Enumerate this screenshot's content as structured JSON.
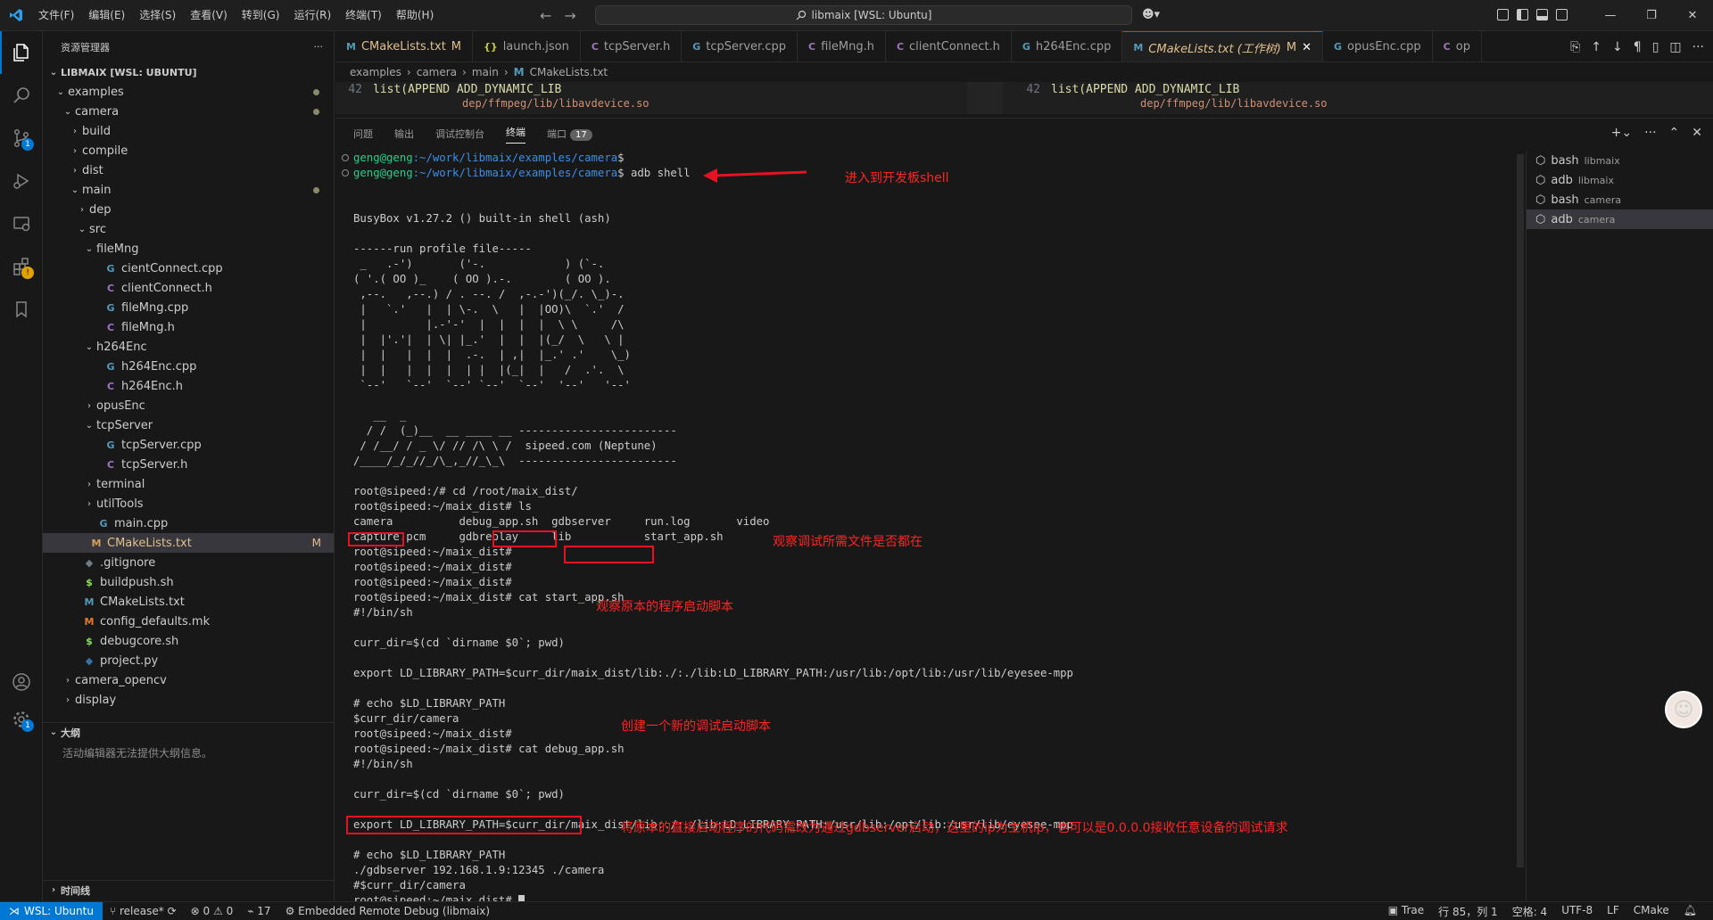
{
  "titlebar": {
    "menu": [
      "文件(F)",
      "编辑(E)",
      "选择(S)",
      "查看(V)",
      "转到(G)",
      "运行(R)",
      "终端(T)",
      "帮助(H)"
    ],
    "search_text": "libmaix [WSL: Ubuntu]"
  },
  "activity": {
    "scm_badge": "1",
    "ext_badge": "!",
    "settings_badge": "1"
  },
  "explorer": {
    "title": "资源管理器",
    "root": "LIBMAIX [WSL: UBUNTU]",
    "items": [
      {
        "label": "examples",
        "depth": 1,
        "chev": "v",
        "icon": "",
        "color": "#cccccc",
        "dot": true
      },
      {
        "label": "camera",
        "depth": 2,
        "chev": "v",
        "icon": "",
        "color": "#cccccc",
        "dot": true
      },
      {
        "label": "build",
        "depth": 3,
        "chev": ">",
        "icon": "",
        "color": "#cccccc"
      },
      {
        "label": "compile",
        "depth": 3,
        "chev": ">",
        "icon": "",
        "color": "#cccccc"
      },
      {
        "label": "dist",
        "depth": 3,
        "chev": ">",
        "icon": "",
        "color": "#cccccc"
      },
      {
        "label": "main",
        "depth": 3,
        "chev": "v",
        "icon": "",
        "color": "#cccccc",
        "dot": true
      },
      {
        "label": "dep",
        "depth": 4,
        "chev": ">",
        "icon": "",
        "color": "#cccccc"
      },
      {
        "label": "src",
        "depth": 4,
        "chev": "v",
        "icon": "",
        "color": "#cccccc"
      },
      {
        "label": "fileMng",
        "depth": 5,
        "chev": "v",
        "icon": "",
        "color": "#cccccc"
      },
      {
        "label": "cientConnect.cpp",
        "depth": 6,
        "chev": "",
        "icon": "G",
        "color": "#519aba"
      },
      {
        "label": "clientConnect.h",
        "depth": 6,
        "chev": "",
        "icon": "C",
        "color": "#a074c4"
      },
      {
        "label": "fileMng.cpp",
        "depth": 6,
        "chev": "",
        "icon": "G",
        "color": "#519aba"
      },
      {
        "label": "fileMng.h",
        "depth": 6,
        "chev": "",
        "icon": "C",
        "color": "#a074c4"
      },
      {
        "label": "h264Enc",
        "depth": 5,
        "chev": "v",
        "icon": "",
        "color": "#cccccc"
      },
      {
        "label": "h264Enc.cpp",
        "depth": 6,
        "chev": "",
        "icon": "G",
        "color": "#519aba"
      },
      {
        "label": "h264Enc.h",
        "depth": 6,
        "chev": "",
        "icon": "C",
        "color": "#a074c4"
      },
      {
        "label": "opusEnc",
        "depth": 5,
        "chev": ">",
        "icon": "",
        "color": "#cccccc"
      },
      {
        "label": "tcpServer",
        "depth": 5,
        "chev": "v",
        "icon": "",
        "color": "#cccccc"
      },
      {
        "label": "tcpServer.cpp",
        "depth": 6,
        "chev": "",
        "icon": "G",
        "color": "#519aba"
      },
      {
        "label": "tcpServer.h",
        "depth": 6,
        "chev": "",
        "icon": "C",
        "color": "#a074c4"
      },
      {
        "label": "terminal",
        "depth": 5,
        "chev": ">",
        "icon": "",
        "color": "#cccccc"
      },
      {
        "label": "utilTools",
        "depth": 5,
        "chev": ">",
        "icon": "",
        "color": "#cccccc"
      },
      {
        "label": "main.cpp",
        "depth": 5,
        "chev": "",
        "icon": "G",
        "color": "#519aba"
      },
      {
        "label": "CMakeLists.txt",
        "depth": 4,
        "chev": "",
        "icon": "M",
        "color": "#d4a05a",
        "selected": true,
        "mod": "M"
      },
      {
        "label": ".gitignore",
        "depth": 3,
        "chev": "",
        "icon": "◆",
        "color": "#6d8086"
      },
      {
        "label": "buildpush.sh",
        "depth": 3,
        "chev": "",
        "icon": "$",
        "color": "#89e051"
      },
      {
        "label": "CMakeLists.txt",
        "depth": 3,
        "chev": "",
        "icon": "M",
        "color": "#519aba"
      },
      {
        "label": "config_defaults.mk",
        "depth": 3,
        "chev": "",
        "icon": "M",
        "color": "#e37933"
      },
      {
        "label": "debugcore.sh",
        "depth": 3,
        "chev": "",
        "icon": "$",
        "color": "#89e051"
      },
      {
        "label": "project.py",
        "depth": 3,
        "chev": "",
        "icon": "◆",
        "color": "#3572a5"
      },
      {
        "label": "camera_opencv",
        "depth": 2,
        "chev": ">",
        "icon": "",
        "color": "#cccccc"
      },
      {
        "label": "display",
        "depth": 2,
        "chev": ">",
        "icon": "",
        "color": "#cccccc"
      }
    ],
    "outline_title": "大纲",
    "outline_empty": "活动编辑器无法提供大纲信息。",
    "timeline_title": "时间线"
  },
  "tabs": [
    {
      "label": "CMakeLists.txt",
      "icon": "M",
      "icon_color": "#519aba",
      "suffix": "M",
      "active": false
    },
    {
      "label": "launch.json",
      "icon": "{}",
      "icon_color": "#cbcb41",
      "suffix": "",
      "active": false
    },
    {
      "label": "tcpServer.h",
      "icon": "C",
      "icon_color": "#a074c4",
      "suffix": "",
      "active": false
    },
    {
      "label": "tcpServer.cpp",
      "icon": "G",
      "icon_color": "#519aba",
      "suffix": "",
      "active": false
    },
    {
      "label": "fileMng.h",
      "icon": "C",
      "icon_color": "#a074c4",
      "suffix": "",
      "active": false
    },
    {
      "label": "clientConnect.h",
      "icon": "C",
      "icon_color": "#a074c4",
      "suffix": "",
      "active": false
    },
    {
      "label": "h264Enc.cpp",
      "icon": "G",
      "icon_color": "#519aba",
      "suffix": "",
      "active": false
    },
    {
      "label": "CMakeLists.txt (工作树)",
      "icon": "M",
      "icon_color": "#519aba",
      "suffix": "M",
      "active": true
    },
    {
      "label": "opusEnc.cpp",
      "icon": "G",
      "icon_color": "#519aba",
      "suffix": "",
      "active": false
    },
    {
      "label": "op",
      "icon": "C",
      "icon_color": "#a074c4",
      "suffix": "",
      "active": false
    }
  ],
  "breadcrumb": [
    "examples",
    "camera",
    "main",
    "CMakeLists.txt"
  ],
  "peek": {
    "line_left": "42",
    "code_left": "list(APPEND ADD_DYNAMIC_LIB",
    "line_right": "42",
    "code_right": "list(APPEND ADD_DYNAMIC_LIB",
    "sub_left": "dep/ffmpeg/lib/libavdevice.so",
    "sub_right": "dep/ffmpeg/lib/libavdevice.so"
  },
  "panel": {
    "tabs": [
      "问题",
      "输出",
      "调试控制台",
      "终端",
      "端口"
    ],
    "ports_count": "17"
  },
  "terminal_lines": [
    {
      "type": "prompt",
      "user": "geng@geng",
      "path": ":~/work/libmaix/examples/camera",
      "cmd": "$",
      "circle": true
    },
    {
      "type": "prompt",
      "user": "geng@geng",
      "path": ":~/work/libmaix/examples/camera",
      "cmd": "$ adb shell",
      "circle": true
    },
    {
      "type": "text",
      "text": ""
    },
    {
      "type": "text",
      "text": ""
    },
    {
      "type": "text",
      "text": "BusyBox v1.27.2 () built-in shell (ash)"
    },
    {
      "type": "text",
      "text": ""
    },
    {
      "type": "text",
      "text": "------run profile file-----"
    },
    {
      "type": "text",
      "text": " _   .-')       ('-.            ) (`-."
    },
    {
      "type": "text",
      "text": "( '.( OO )_    ( OO ).-.        ( OO )."
    },
    {
      "type": "text",
      "text": " ,--.   ,--.) / . --. /  ,-.-')(_/. \\_)-."
    },
    {
      "type": "text",
      "text": " |   `.'   |  | \\-.  \\   |  |OO)\\  `.'  /"
    },
    {
      "type": "text",
      "text": " |         |.-'-'  |  |  |  |  \\ \\     /\\"
    },
    {
      "type": "text",
      "text": " |  |'.'|  | \\| |_.'  |  |  |(_/  \\   \\ |"
    },
    {
      "type": "text",
      "text": " |  |   |  |  |  .-.  | ,|  |_.' .'    \\_)"
    },
    {
      "type": "text",
      "text": " |  |   |  |  |  | |  |(_|  |   /  .'.  \\"
    },
    {
      "type": "text",
      "text": " `--'   `--'  `--' `--'  `--'  '--'   '--'"
    },
    {
      "type": "text",
      "text": ""
    },
    {
      "type": "text",
      "text": "   __  _"
    },
    {
      "type": "text",
      "text": "  / /  (_)__  __ ____ __ ------------------------"
    },
    {
      "type": "text",
      "text": " / /__/ / _ \\/ // /\\ \\ /  sipeed.com (Neptune)"
    },
    {
      "type": "text",
      "text": "/____/_/_//_/\\_,_//_\\_\\  ------------------------"
    },
    {
      "type": "text",
      "text": ""
    },
    {
      "type": "text",
      "text": "root@sipeed:/# cd /root/maix_dist/"
    },
    {
      "type": "text",
      "text": "root@sipeed:~/maix_dist# ls"
    },
    {
      "type": "text",
      "text": "camera          debug_app.sh  gdbserver     run.log       video"
    },
    {
      "type": "text",
      "text": "capture.pcm     gdbreplay     lib           start_app.sh"
    },
    {
      "type": "text",
      "text": "root@sipeed:~/maix_dist#"
    },
    {
      "type": "text",
      "text": "root@sipeed:~/maix_dist#"
    },
    {
      "type": "text",
      "text": "root@sipeed:~/maix_dist#"
    },
    {
      "type": "text",
      "text": "root@sipeed:~/maix_dist# cat start_app.sh"
    },
    {
      "type": "text",
      "text": "#!/bin/sh"
    },
    {
      "type": "text",
      "text": ""
    },
    {
      "type": "text",
      "text": "curr_dir=$(cd `dirname $0`; pwd)"
    },
    {
      "type": "text",
      "text": ""
    },
    {
      "type": "text",
      "text": "export LD_LIBRARY_PATH=$curr_dir/maix_dist/lib:./:./lib:LD_LIBRARY_PATH:/usr/lib:/opt/lib:/usr/lib/eyesee-mpp"
    },
    {
      "type": "text",
      "text": ""
    },
    {
      "type": "text",
      "text": "# echo $LD_LIBRARY_PATH"
    },
    {
      "type": "text",
      "text": "$curr_dir/camera"
    },
    {
      "type": "text",
      "text": "root@sipeed:~/maix_dist#"
    },
    {
      "type": "text",
      "text": "root@sipeed:~/maix_dist# cat debug_app.sh"
    },
    {
      "type": "text",
      "text": "#!/bin/sh"
    },
    {
      "type": "text",
      "text": ""
    },
    {
      "type": "text",
      "text": "curr_dir=$(cd `dirname $0`; pwd)"
    },
    {
      "type": "text",
      "text": ""
    },
    {
      "type": "text",
      "text": "export LD_LIBRARY_PATH=$curr_dir/maix_dist/lib:./:./lib:LD_LIBRARY_PATH:/usr/lib:/opt/lib:/usr/lib/eyesee-mpp"
    },
    {
      "type": "text",
      "text": ""
    },
    {
      "type": "text",
      "text": "# echo $LD_LIBRARY_PATH"
    },
    {
      "type": "text",
      "text": "./gdbserver 192.168.1.9:12345 ./camera"
    },
    {
      "type": "text",
      "text": "#$curr_dir/camera"
    },
    {
      "type": "cursor",
      "text": "root@sipeed:~/maix_dist# "
    }
  ],
  "annotations": {
    "adb_shell": "进入到开发板shell",
    "check_files": "观察调试所需文件是否都在",
    "start_script": "观察原本的程序启动脚本",
    "debug_script": "创建一个新的调试启动脚本",
    "gdbserver_note": "将原本的直接启动程序的代码需改为通过gdbserver启动，这里的ip为主机ip，也可以是0.0.0.0接收任意设备的调试请求"
  },
  "terminals": [
    {
      "name": "bash",
      "sub": "libmaix",
      "active": false
    },
    {
      "name": "adb",
      "sub": "libmaix",
      "active": false
    },
    {
      "name": "bash",
      "sub": "camera",
      "active": false
    },
    {
      "name": "adb",
      "sub": "camera",
      "active": true
    }
  ],
  "status": {
    "remote": "WSL: Ubuntu",
    "branch": "release*",
    "errors": "0",
    "warnings": "0",
    "ports": "17",
    "debug": "Embedded Remote Debug (libmaix)",
    "trae": "Trae",
    "position": "行 85，列 1",
    "spaces": "空格: 4",
    "encoding": "UTF-8",
    "eol": "LF",
    "language": "CMake"
  }
}
